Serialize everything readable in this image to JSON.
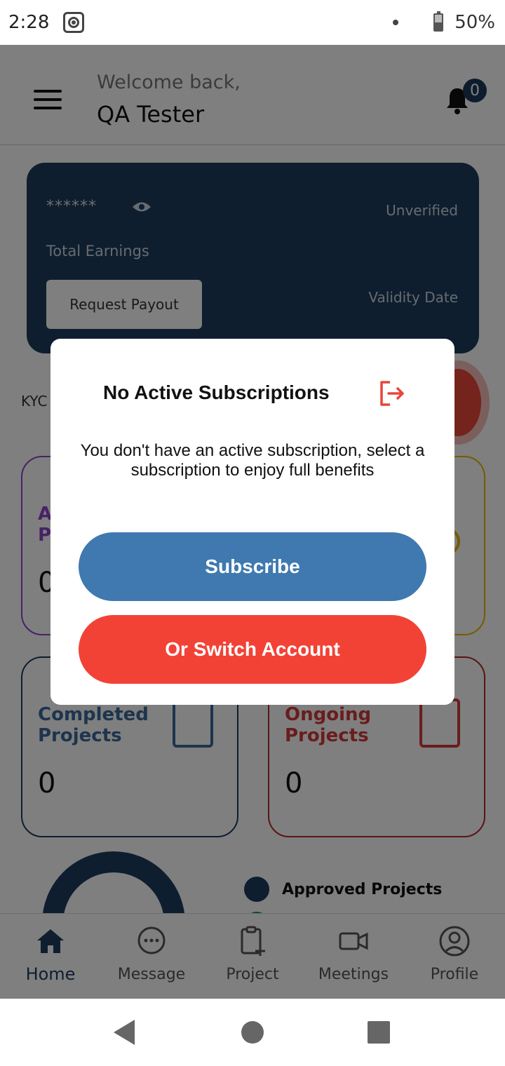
{
  "status_bar": {
    "time": "2:28",
    "battery": "50%"
  },
  "header": {
    "welcome": "Welcome back,",
    "username": "QA Tester",
    "notification_count": "0"
  },
  "earnings_card": {
    "masked_amount": "******",
    "status": "Unverified",
    "total_label": "Total Earnings",
    "payout_button": "Request Payout",
    "validity_label": "Validity Date"
  },
  "kyc_label": "KYC",
  "cards": {
    "purple": {
      "title": "A\nP",
      "value": "0"
    },
    "completed": {
      "title": "Completed\nProjects",
      "value": "0"
    },
    "ongoing": {
      "title": "Ongoing\nProjects",
      "value": "0"
    }
  },
  "chart_legend": {
    "approved": "Approved Projects"
  },
  "bottom_nav": {
    "home": "Home",
    "message": "Message",
    "project": "Project",
    "meetings": "Meetings",
    "profile": "Profile"
  },
  "modal": {
    "title": "No Active Subscriptions",
    "body": "You don't have an active subscription, select a subscription to enjoy full benefits",
    "subscribe_button": "Subscribe",
    "switch_button": "Or Switch Account"
  },
  "colors": {
    "primary": "#1d3c5e",
    "subscribe": "#3f79b0",
    "switch": "#f24236"
  }
}
